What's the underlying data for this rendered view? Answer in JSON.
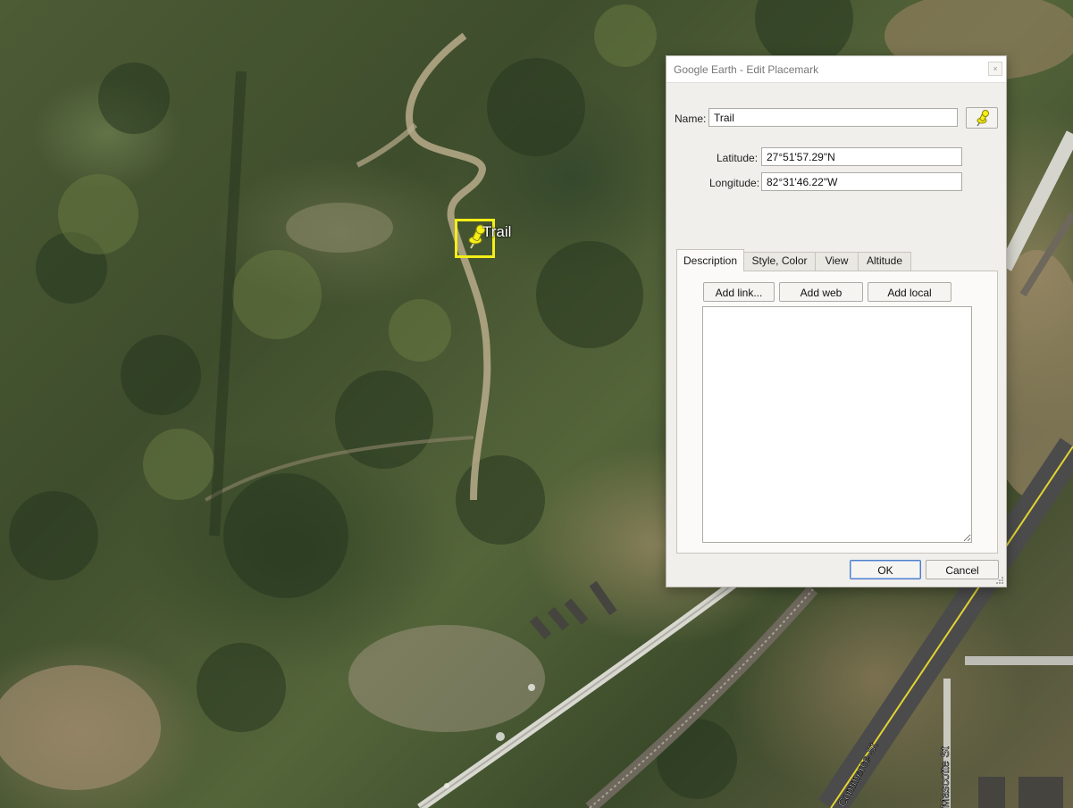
{
  "map": {
    "placemark_label": "Trail",
    "road_labels": [
      "Commerce St",
      "Mascotte St"
    ],
    "colors": {
      "selection_box": "#f5ee17",
      "pin": "#f5ee17"
    }
  },
  "dialog": {
    "title": "Google Earth - Edit Placemark",
    "close_glyph": "×",
    "name_label": "Name:",
    "name_value": "Trail",
    "latitude_label": "Latitude:",
    "latitude_value": "27°51'57.29\"N",
    "longitude_label": "Longitude:",
    "longitude_value": "82°31'46.22\"W",
    "pin_style_icon": "yellow-pushpin-icon",
    "tabs": [
      {
        "label": "Description",
        "active": true
      },
      {
        "label": "Style, Color",
        "active": false
      },
      {
        "label": "View",
        "active": false
      },
      {
        "label": "Altitude",
        "active": false
      }
    ],
    "buttons": {
      "add_link": "Add link...",
      "add_web_image": "Add web image...",
      "add_local_image": "Add local image..."
    },
    "description_value": "",
    "ok_label": "OK",
    "cancel_label": "Cancel"
  }
}
